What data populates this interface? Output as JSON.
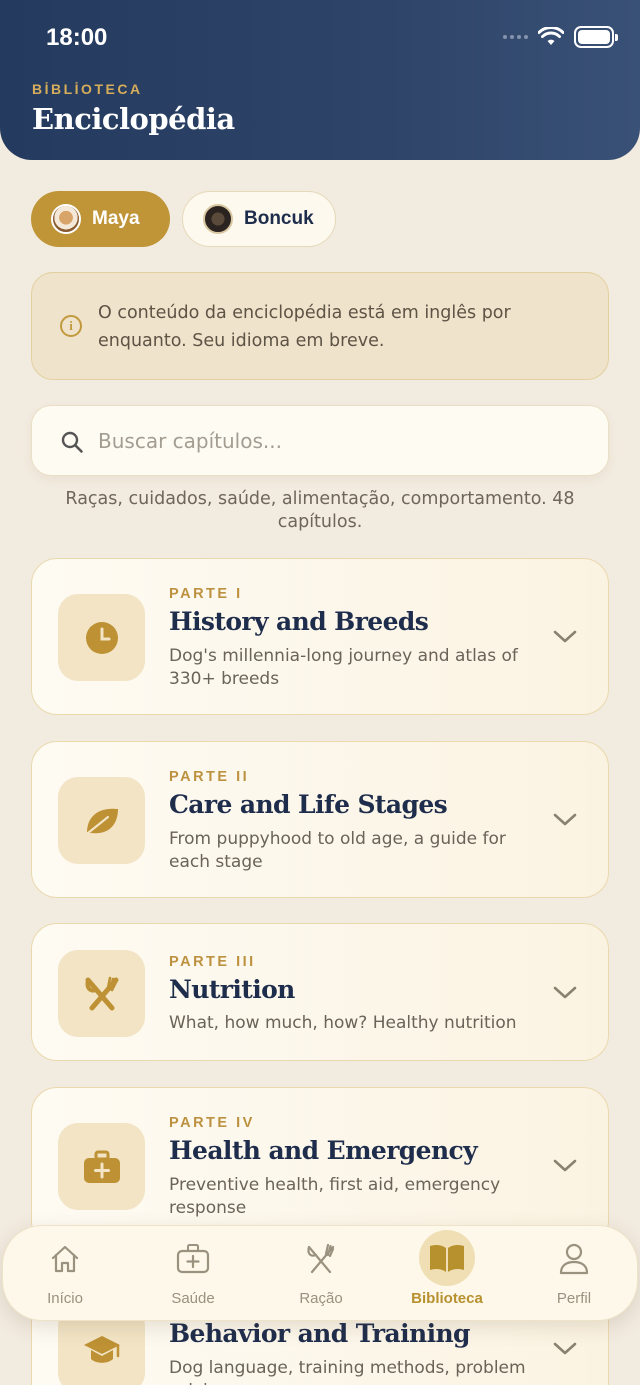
{
  "status_bar": {
    "time": "18:00"
  },
  "header": {
    "eyebrow": "BİBLİOTECA",
    "title": "Enciclopédia"
  },
  "pets": [
    {
      "name": "Maya",
      "selected": true
    },
    {
      "name": "Boncuk",
      "selected": false
    }
  ],
  "notice": {
    "text": "O conteúdo da enciclopédia está em inglês por enquanto. Seu idioma em breve."
  },
  "search": {
    "placeholder": "Buscar capítulos...",
    "value": ""
  },
  "summary": "Raças, cuidados, saúde, alimentação, comportamento. 48 capítulos.",
  "chapters": [
    {
      "part": "PARTE I",
      "title": "History and Breeds",
      "description": "Dog's millennia-long journey and atlas of 330+ breeds",
      "icon": "clock-icon"
    },
    {
      "part": "PARTE II",
      "title": "Care and Life Stages",
      "description": "From puppyhood to old age, a guide for each stage",
      "icon": "leaf-icon"
    },
    {
      "part": "PARTE III",
      "title": "Nutrition",
      "description": "What, how much, how? Healthy nutrition",
      "icon": "fork-knife-icon"
    },
    {
      "part": "PARTE IV",
      "title": "Health and Emergency",
      "description": "Preventive health, first aid, emergency response",
      "icon": "medical-kit-icon"
    },
    {
      "part": "",
      "title": "Behavior and Training",
      "description": "Dog language, training methods, problem solving",
      "icon": "graduation-cap-icon"
    }
  ],
  "tabs": [
    {
      "label": "Início",
      "icon": "home-icon"
    },
    {
      "label": "Saúde",
      "icon": "medical-icon"
    },
    {
      "label": "Ração",
      "icon": "fork-knife-icon"
    },
    {
      "label": "Biblioteca",
      "icon": "book-icon",
      "active": true
    },
    {
      "label": "Perfil",
      "icon": "person-icon"
    }
  ],
  "colors": {
    "accent": "#bf9537",
    "header": "#243a5e",
    "background": "#f2ebdf"
  }
}
